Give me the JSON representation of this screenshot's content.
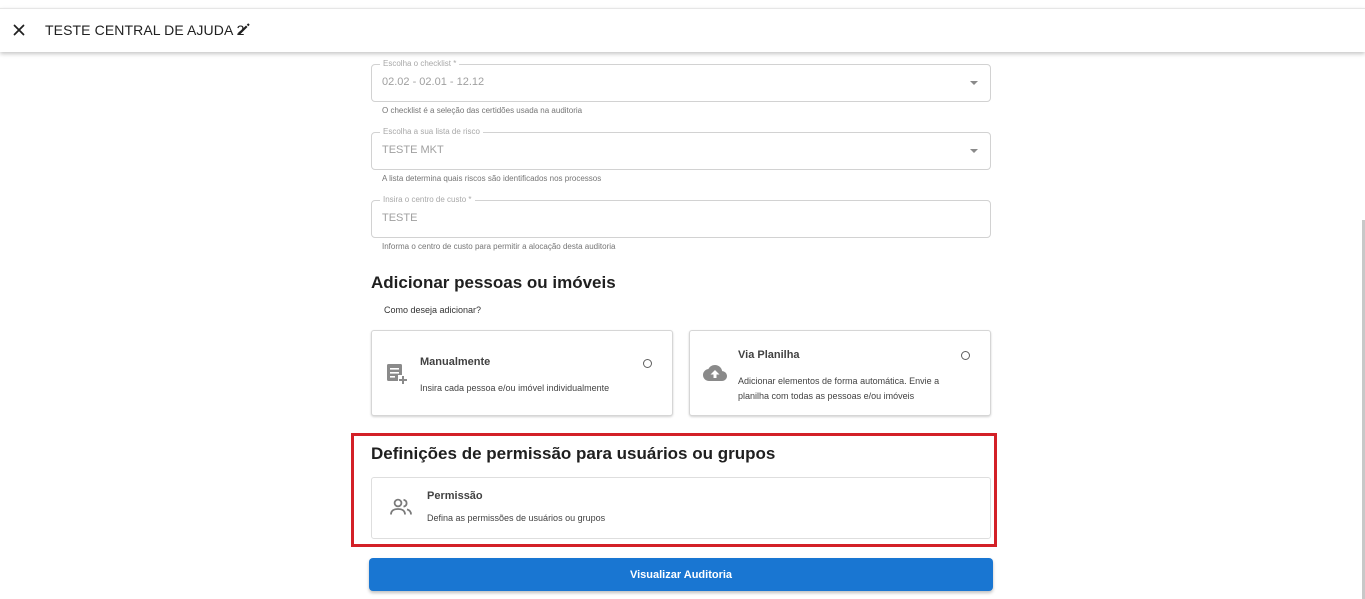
{
  "header": {
    "title": "TESTE CENTRAL DE AJUDA 2",
    "close_icon": "close-icon",
    "edit_icon": "pencil-icon"
  },
  "form": {
    "checklist": {
      "label": "Escolha o checklist *",
      "value": "02.02 - 02.01 - 12.12",
      "helper": "O checklist é a seleção das certidões usada na auditoria"
    },
    "risk_list": {
      "label": "Escolha a sua lista de risco",
      "value": "TESTE MKT",
      "helper": "A lista determina quais riscos são identificados nos processos"
    },
    "cost_center": {
      "label": "Insira o centro de custo *",
      "value": "TESTE",
      "helper": "Informa o centro de custo para permitir a alocação desta auditoria"
    }
  },
  "add_section": {
    "title": "Adicionar pessoas ou imóveis",
    "question": "Como deseja adicionar?",
    "options": [
      {
        "title": "Manualmente",
        "description": "Insira cada pessoa e/ou imóvel individualmente",
        "icon": "add-note-icon",
        "selected": false
      },
      {
        "title": "Via Planilha",
        "description_line1": "Adicionar elementos de forma automática. Envie a",
        "description_line2": "planilha com todas as pessoas e/ou imóveis",
        "icon": "cloud-upload-icon",
        "selected": false
      }
    ]
  },
  "permission_section": {
    "title": "Definições de permissão para usuários ou grupos",
    "card_title": "Permissão",
    "card_description": "Defina as permissões de usuários ou grupos",
    "icon": "people-icon",
    "highlight_color": "#d32027"
  },
  "actions": {
    "primary_label": "Visualizar Auditoria",
    "primary_color": "#1976d2"
  }
}
